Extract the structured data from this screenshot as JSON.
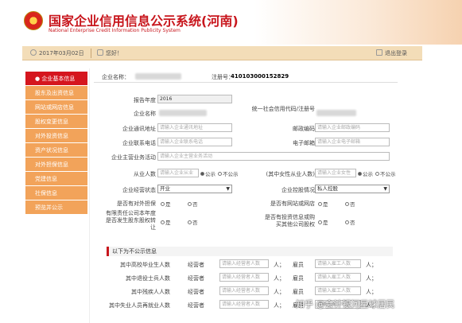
{
  "header": {
    "title": "国家企业信用信息公示系统(河南)",
    "subtitle": "National Enterprise Credit Information Publicity System"
  },
  "topbar": {
    "date": "2017年03月02日",
    "greeting": "您好！",
    "logout": "退出登录"
  },
  "sidebar": {
    "items": [
      {
        "label": "企业基本信息",
        "active": true
      },
      {
        "label": "股东及出资信息",
        "active": false
      },
      {
        "label": "网站或网店信息",
        "active": false
      },
      {
        "label": "股权变更信息",
        "active": false
      },
      {
        "label": "对外投资信息",
        "active": false
      },
      {
        "label": "资产状况信息",
        "active": false
      },
      {
        "label": "对外担保信息",
        "active": false
      },
      {
        "label": "党建信息",
        "active": false
      },
      {
        "label": "社保信息",
        "active": false
      },
      {
        "label": "预览并公示",
        "active": false
      }
    ]
  },
  "company": {
    "name_label": "企业名称：",
    "reg_label": "注册号：",
    "reg_value": "410103000152829"
  },
  "form": {
    "year_label": "报告年度",
    "year_value": "2016",
    "name_label": "企业名称",
    "credit_code_label": "统一社会信用代码/注册号",
    "address_label": "企业通讯地址",
    "address_placeholder": "请输入企业通讯地址",
    "postcode_label": "邮政编码",
    "postcode_placeholder": "请输入企业邮政编码",
    "phone_label": "企业联系电话",
    "phone_placeholder": "请输入企业联系电话",
    "email_label": "电子邮箱",
    "email_placeholder": "请输入企业电子邮箱",
    "business_label": "企业主营业务活动",
    "business_placeholder": "请输入企业主营业务活动",
    "employees_label": "从业人数",
    "employees_placeholder": "请输入企业从业",
    "public_label": "公示",
    "not_public_label": "不公示",
    "female_label": "(其中女性从业人数)",
    "female_placeholder": "请输入企业女性",
    "status_label": "企业经营状态",
    "status_value": "开业",
    "holding_label": "企业控股情况",
    "holding_value": "私人控股",
    "guarantee_label": "是否有对外担保",
    "website_label": "是否有网站或网店",
    "yes_label": "是",
    "no_label": "否",
    "transfer_label": "有限责任公司本年度是否发生股东股权转让",
    "invest_label": "是否有投资信息或购买其他公司股权"
  },
  "non_public": {
    "heading": "以下为不公示信息",
    "rows": [
      {
        "label": "其中高校毕业生人数",
        "a": "经营者",
        "a_ph": "请输入经营者人数",
        "unit": "人；",
        "b": "雇员",
        "b_ph": "请输入雇工人数",
        "unit2": "人；"
      },
      {
        "label": "其中退役士兵人数",
        "a": "经营者",
        "a_ph": "请输入经营者人数",
        "unit": "人；",
        "b": "雇员",
        "b_ph": "请输入雇工人数",
        "unit2": "人；"
      },
      {
        "label": "其中残疾人人数",
        "a": "经营者",
        "a_ph": "请输入经营者人数",
        "unit": "人；",
        "b": "雇员",
        "b_ph": "请输入雇工人数",
        "unit2": "人；"
      },
      {
        "label": "其中失业人员再就业人数",
        "a": "经营者",
        "a_ph": "请输入经营者人数",
        "unit": "人；",
        "b": "雇员",
        "b_ph": "请输入雇工人数",
        "unit2": "人；"
      }
    ]
  },
  "watermark": "知乎 @会计银河星球居民"
}
